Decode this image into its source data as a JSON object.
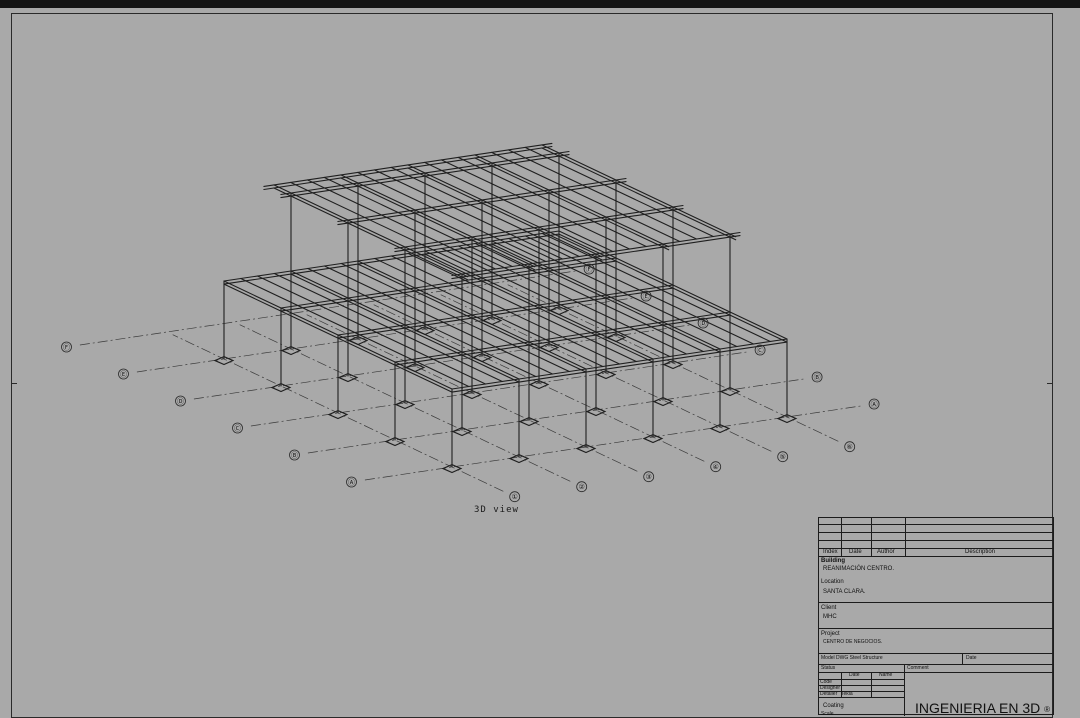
{
  "view_label": "3D view",
  "grid_numbers": [
    "①",
    "②",
    "③",
    "④",
    "⑤",
    "⑥"
  ],
  "grid_letters": [
    "Ⓐ",
    "Ⓑ",
    "Ⓒ",
    "Ⓓ",
    "Ⓔ",
    "Ⓕ"
  ],
  "title_block": {
    "revision_headers": {
      "index": "Index",
      "date": "Date",
      "author": "Author",
      "description": "Description"
    },
    "building_label": "Building",
    "building_value": "REANIMACIÓN CENTRO.",
    "location_label": "Location",
    "location_value": "SANTA CLARA.",
    "client_label": "Client",
    "client_value": "MHC",
    "project_label": "Project",
    "project_value": "CENTRO DE NEGOCIOS.",
    "model_label": "Model DWG Steel Structure",
    "date_label": "Date",
    "status_label": "Status",
    "comment_label": "Comment",
    "date_col": "Date",
    "name_col": "Name",
    "code_label": "Code",
    "designer_label": "Designer",
    "detailer_label": "Detailer",
    "detailer_value": "Tekla",
    "coating_label": "Coating",
    "scale_label": "Scale",
    "brand": "INGENIERIA EN 3D",
    "brand_mark": "®"
  },
  "colors": {
    "background": "#a9a9a9",
    "line": "#1f1f1f",
    "grid_line": "#3a3a3a"
  }
}
